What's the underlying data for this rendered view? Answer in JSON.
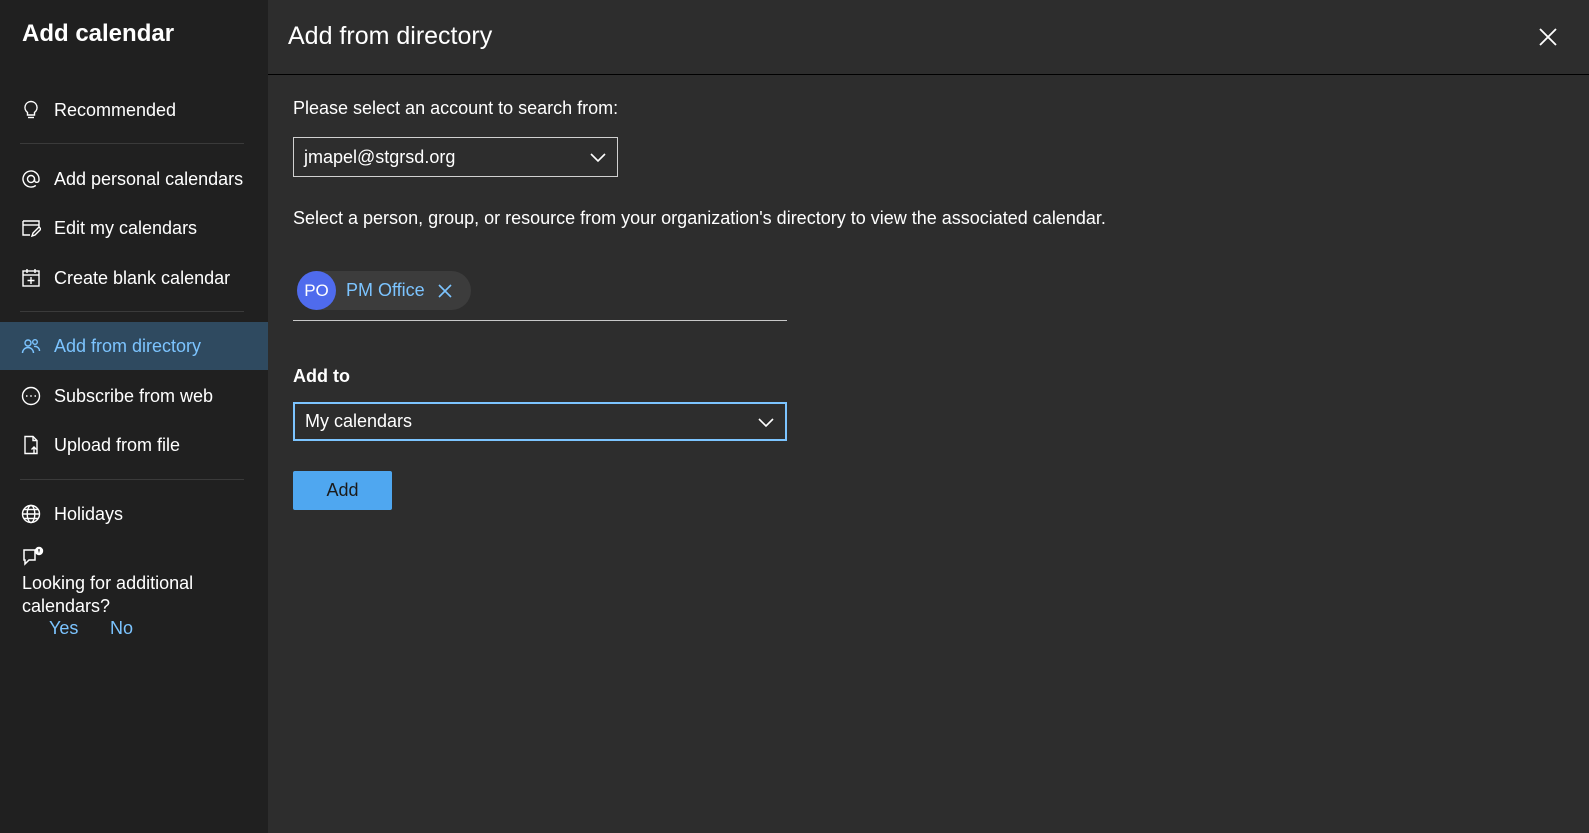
{
  "sidebar": {
    "title": "Add calendar",
    "items": [
      {
        "label": "Recommended",
        "icon": "lightbulb-icon"
      },
      {
        "label": "Add personal calendars",
        "icon": "at-sign-icon"
      },
      {
        "label": "Edit my calendars",
        "icon": "edit-calendar-icon"
      },
      {
        "label": "Create blank calendar",
        "icon": "calendar-add-icon"
      },
      {
        "label": "Add from directory",
        "icon": "people-icon",
        "active": true
      },
      {
        "label": "Subscribe from web",
        "icon": "web-subscribe-icon"
      },
      {
        "label": "Upload from file",
        "icon": "file-upload-icon"
      },
      {
        "label": "Holidays",
        "icon": "globe-icon"
      }
    ],
    "feedback": {
      "icon": "feedback-icon",
      "text": "Looking for additional calendars?",
      "yes": "Yes",
      "no": "No"
    }
  },
  "main": {
    "title": "Add from directory",
    "close_icon": "close-icon",
    "account_prompt": "Please select an account to search from:",
    "account_value": "jmapel@stgrsd.org",
    "directory_prompt": "Select a person, group, or resource from your organization's directory to view the associated calendar.",
    "selected_person": {
      "initials": "PO",
      "name": "PM Office"
    },
    "add_to_label": "Add to",
    "add_to_value": "My calendars",
    "add_button": "Add"
  },
  "colors": {
    "accent": "#7cc4ff",
    "button": "#4fa7f0",
    "avatar": "#4f6bed",
    "sidebar_bg": "#202020",
    "main_bg": "#2d2d2d",
    "active_bg": "#2f4a60"
  }
}
